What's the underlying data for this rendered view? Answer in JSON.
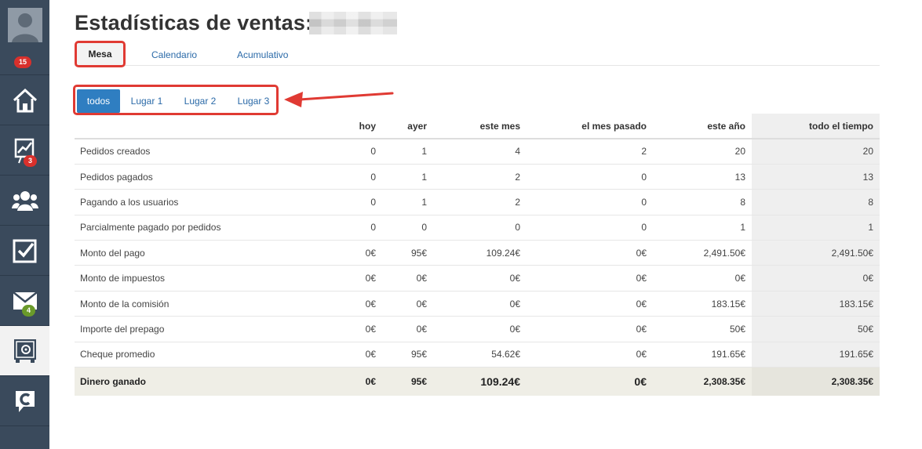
{
  "sidebar": {
    "items": [
      {
        "icon": "user-avatar-icon",
        "badge": "15",
        "badge_color": "#d9302c"
      },
      {
        "icon": "home-icon",
        "badge": ""
      },
      {
        "icon": "chart-board-icon",
        "badge": "3",
        "badge_color": "#d9302c"
      },
      {
        "icon": "users-group-icon",
        "badge": ""
      },
      {
        "icon": "checkbox-icon",
        "badge": ""
      },
      {
        "icon": "mail-icon",
        "badge": "4",
        "badge_color": "#6a9a2a"
      },
      {
        "icon": "safe-icon",
        "badge": "",
        "active": true
      },
      {
        "icon": "chat-c-icon",
        "badge": ""
      }
    ]
  },
  "header": {
    "title": "Estadísticas de ventas:"
  },
  "tabs": [
    {
      "label": "Mesa",
      "active": true
    },
    {
      "label": "Calendario"
    },
    {
      "label": "Acumulativo"
    }
  ],
  "filters": [
    {
      "label": "todos",
      "active": true
    },
    {
      "label": "Lugar 1"
    },
    {
      "label": "Lugar 2"
    },
    {
      "label": "Lugar 3"
    }
  ],
  "table": {
    "columns": [
      "",
      "hoy",
      "ayer",
      "este mes",
      "el mes pasado",
      "este año",
      "todo el tiempo"
    ],
    "rows": [
      [
        "Pedidos creados",
        "0",
        "1",
        "4",
        "2",
        "20",
        "20"
      ],
      [
        "Pedidos pagados",
        "0",
        "1",
        "2",
        "0",
        "13",
        "13"
      ],
      [
        "Pagando a los usuarios",
        "0",
        "1",
        "2",
        "0",
        "8",
        "8"
      ],
      [
        "Parcialmente pagado por pedidos",
        "0",
        "0",
        "0",
        "0",
        "1",
        "1"
      ],
      [
        "Monto del pago",
        "0€",
        "95€",
        "109.24€",
        "0€",
        "2,491.50€",
        "2,491.50€"
      ],
      [
        "Monto de impuestos",
        "0€",
        "0€",
        "0€",
        "0€",
        "0€",
        "0€"
      ],
      [
        "Monto de la comisión",
        "0€",
        "0€",
        "0€",
        "0€",
        "183.15€",
        "183.15€"
      ],
      [
        "Importe del prepago",
        "0€",
        "0€",
        "0€",
        "0€",
        "50€",
        "50€"
      ],
      [
        "Cheque promedio",
        "0€",
        "95€",
        "54.62€",
        "0€",
        "191.65€",
        "191.65€"
      ]
    ],
    "total": [
      "Dinero ganado",
      "0€",
      "95€",
      "109.24€",
      "0€",
      "2,308.35€",
      "2,308.35€"
    ]
  },
  "colors": {
    "sidebar": "#3a4a5c",
    "accent_blue": "#2f7ec1",
    "highlight_red": "#e03a33"
  }
}
